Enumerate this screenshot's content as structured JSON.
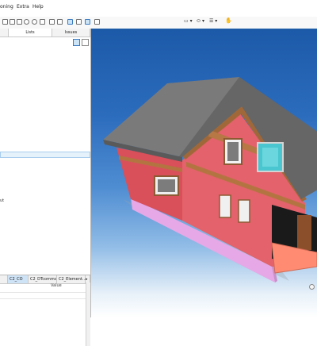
{
  "menu": {
    "items": [
      "oning",
      "Extra",
      "Help"
    ]
  },
  "toolbar": {
    "view_dropdown_1": "▭ ▾",
    "view_dropdown_2": "⬭ ▾",
    "view_dropdown_3": "☰ ▾"
  },
  "left_panel": {
    "tabs": [
      "",
      "Lists",
      "Issues"
    ],
    "tree_fragment": "ut",
    "property_tabs": [
      "",
      "C2_CO",
      "C2_DTcommon",
      "C2_Element...",
      "▸"
    ],
    "property_header": "Value"
  },
  "colors": {
    "sky_top": "#1c5aa8",
    "wall": "#e15b63",
    "roof": "#6f6f6f",
    "window_glass": "#49c6cf",
    "base_band": "#e6a8e6",
    "selection": "#e5f1fb"
  },
  "icons": [
    "undo-icon",
    "redo-icon",
    "select-icon",
    "orbit-icon",
    "hand-icon",
    "menu-icon"
  ]
}
